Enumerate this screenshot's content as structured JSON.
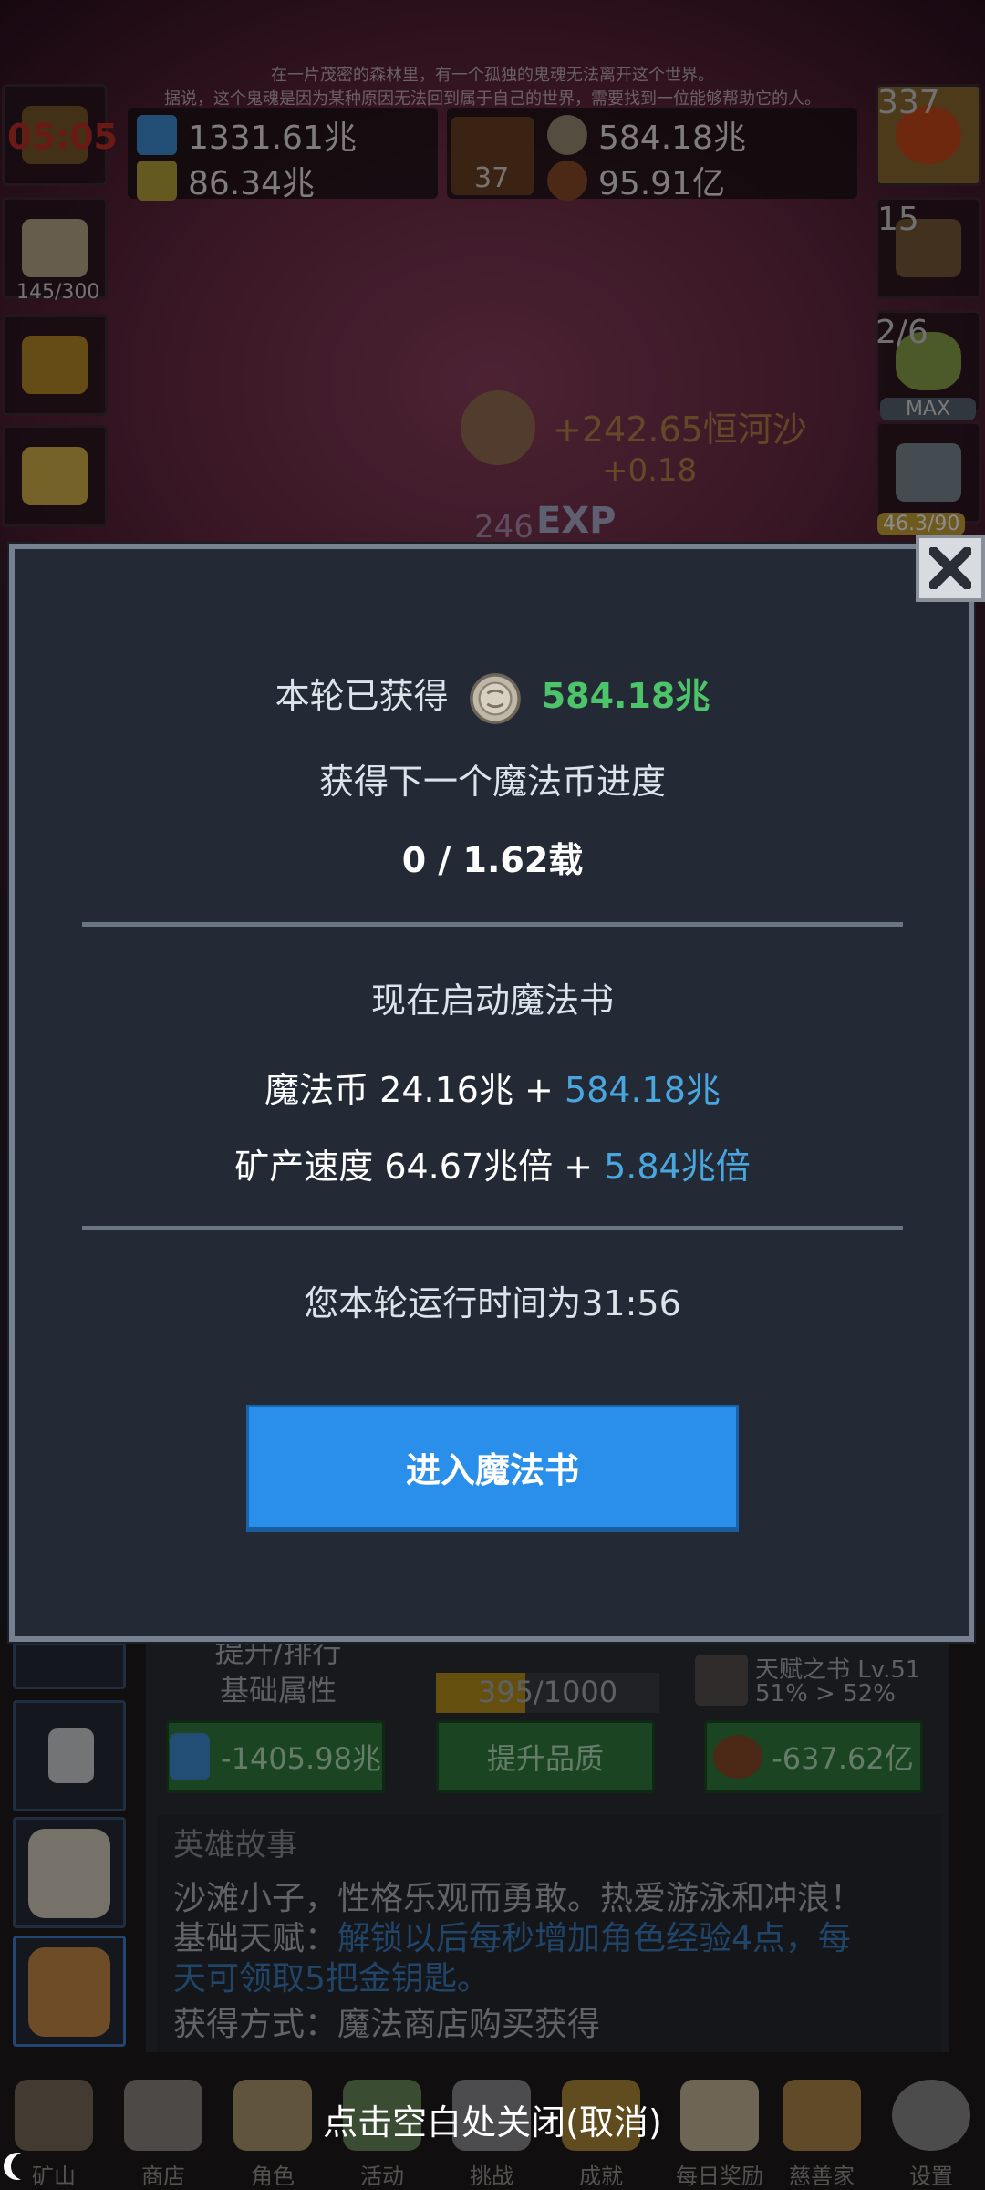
{
  "background": {
    "story_line_1": "在一片茂密的森林里，有一个孤独的鬼魂无法离开这个世界。",
    "story_line_2": "据说，这个鬼魂是因为某种原因无法回到属于自己的世界，需要找到一位能够帮助它的人。",
    "timer": "05:05",
    "resources": {
      "blue_potion": "1331.61兆",
      "yellow_potion": "86.34兆",
      "book_count": "37",
      "coin": "584.18兆",
      "meat": "95.91亿"
    },
    "left_slots": {
      "beer_count": "145/300"
    },
    "right_slots": {
      "potion_count": "337",
      "chest_count": "15",
      "slime_count": "2/6",
      "slime_max": "MAX",
      "sword_count": "46.3/90"
    },
    "floating_text_1": "+242.65恒河沙",
    "floating_text_2": "+0.18",
    "floating_text_3": "246",
    "exp_label": "EXP",
    "bottom": {
      "upgrade_label_line1": "提升/排行",
      "upgrade_label_line2": "基础属性",
      "quality_progress": "395/1000",
      "talent_book": "天赋之书 Lv.51",
      "talent_progress": "51% > 52%",
      "btn_cost_1": "-1405.98兆",
      "btn_quality": "提升品质",
      "btn_cost_2": "-637.62亿",
      "story_title": "英雄故事",
      "story_desc": "沙滩小子，性格乐观而勇敢。热爱游泳和冲浪！",
      "talent_prefix": "基础天赋：",
      "talent_text_1": "解锁以后每秒增加角色经验4点，每",
      "talent_text_2": "天可领取5把金钥匙。",
      "acquire": "获得方式：魔法商店购买获得"
    },
    "nav": [
      "矿山",
      "商店",
      "角色",
      "活动",
      "挑战",
      "成就",
      "每日奖励",
      "慈善家",
      "设置"
    ]
  },
  "dialog": {
    "earned_label": "本轮已获得",
    "earned_value": "584.18兆",
    "progress_label": "获得下一个魔法币进度",
    "progress_value": "0 / 1.62载",
    "activate_label": "现在启动魔法书",
    "magic_coin_label": "魔法币 24.16兆 + ",
    "magic_coin_bonus": "584.18兆",
    "mining_label": "矿产速度 64.67兆倍 + ",
    "mining_bonus": "5.84兆倍",
    "runtime": "您本轮运行时间为31:56",
    "enter_button": "进入魔法书"
  },
  "close_hint": "点击空白处关闭(取消)"
}
